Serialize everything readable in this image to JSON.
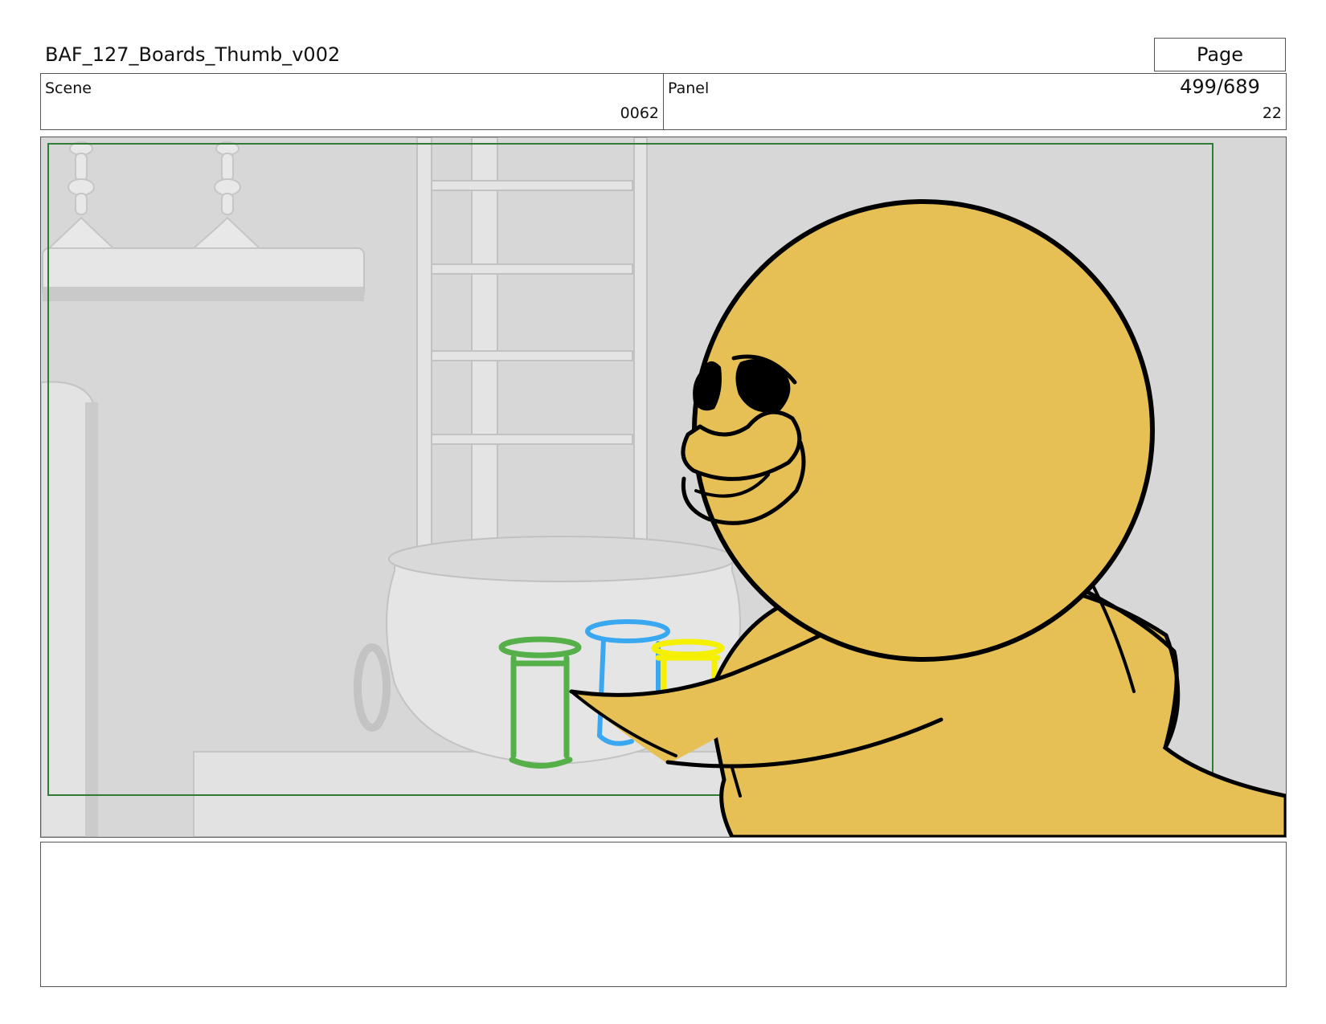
{
  "header": {
    "title": "BAF_127_Boards_Thumb_v002",
    "page": "Page 499/689"
  },
  "info": {
    "scene_label": "Scene",
    "scene_value": "0062",
    "panel_label": "Panel",
    "panel_value": "22"
  },
  "frame": {
    "description_icons": [
      "shelf",
      "ladder",
      "cauldron",
      "green-jar",
      "blue-jar",
      "yellow-jar",
      "yellow-duck-character"
    ],
    "colors": {
      "background_wall": "#d6d6d6",
      "character_fill": "#e6c055",
      "safe_area_border": "#2e7d32",
      "jar_green": "#55b04a",
      "jar_blue": "#3aa8f0",
      "jar_yellow": "#f5f000"
    }
  },
  "notes": {
    "text": ""
  }
}
